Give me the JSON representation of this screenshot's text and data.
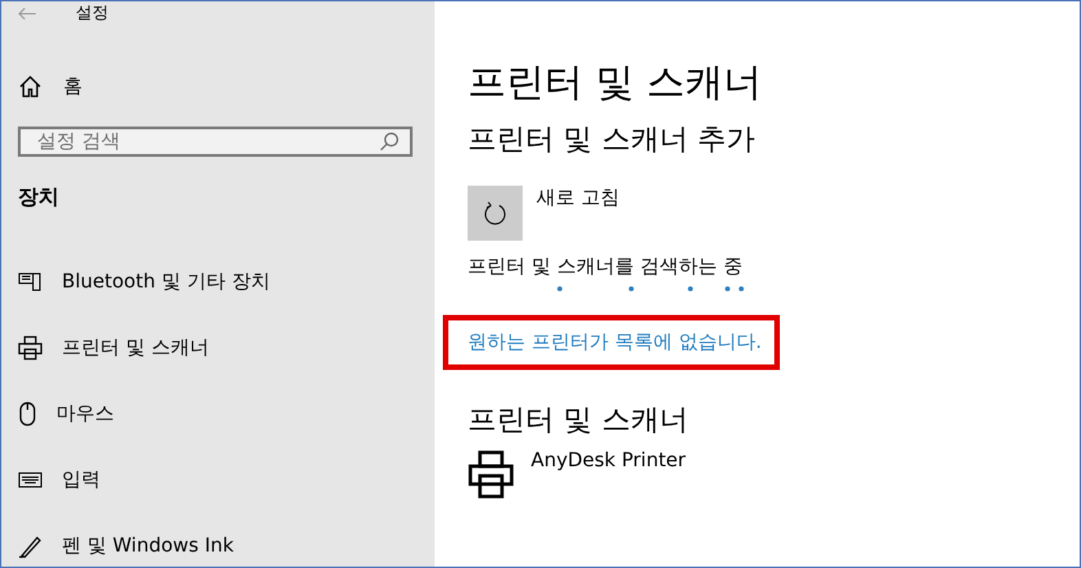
{
  "window": {
    "title": "설정"
  },
  "sidebar": {
    "home": "홈",
    "search": {
      "placeholder": "설정 검색"
    },
    "section": "장치",
    "items": [
      {
        "kind": "bluetooth",
        "label": "Bluetooth 및 기타 장치"
      },
      {
        "kind": "printer",
        "label": "프린터 및 스캐너"
      },
      {
        "kind": "mouse",
        "label": "마우스"
      },
      {
        "kind": "keyboard",
        "label": "입력"
      },
      {
        "kind": "pen",
        "label": "펜 및 Windows Ink"
      }
    ]
  },
  "main": {
    "title": "프린터 및 스캐너",
    "add_heading": "프린터 및 스캐너 추가",
    "refresh": "새로 고침",
    "searching": "프린터 및 스캐너를 검색하는 중",
    "missing_link": {
      "text": "원하는 프린터가 목록에 없습니다.",
      "highlighted": true
    },
    "list_heading": "프린터 및 스캐너",
    "printers": [
      {
        "name": "AnyDesk Printer"
      }
    ]
  }
}
